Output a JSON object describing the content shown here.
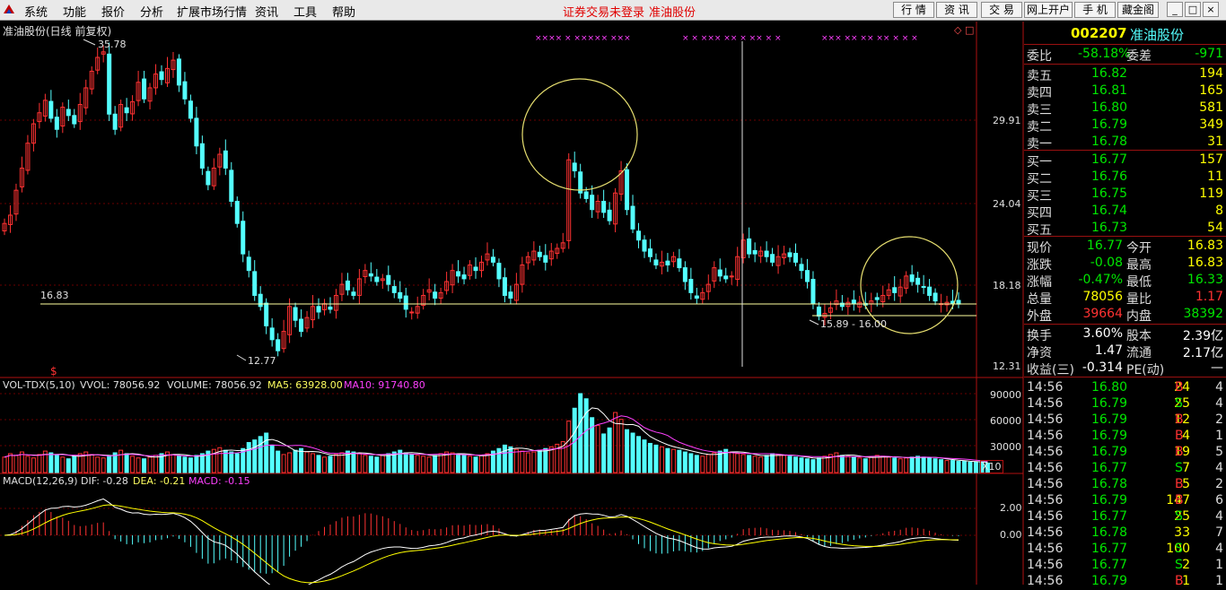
{
  "menubar": {
    "items": [
      "系统",
      "功能",
      "报价",
      "分析",
      "扩展市场行情",
      "资讯",
      "工具",
      "帮助"
    ],
    "notice": "证券交易未登录",
    "stock_name": "准油股份",
    "right_buttons": [
      "行 情",
      "资 讯",
      "交 易",
      "网上开户",
      "手 机",
      "藏金阁"
    ],
    "window_buttons": [
      "_",
      "□",
      "×"
    ]
  },
  "chart_header": {
    "title": "准油股份(日线 前复权)",
    "high_label": "35.78",
    "low_label": "12.77",
    "price_line_label": "16.83",
    "range_label": "15.89 - 16.00",
    "top_right_symbols": "◇ □"
  },
  "price_axis": {
    "ticks": [
      "29.91",
      "24.04",
      "18.18",
      "12.31"
    ]
  },
  "volume_panel": {
    "indicator": "VOL-TDX(5,10)",
    "vvol": "VVOL: 78056.92",
    "volume": "VOLUME: 78056.92",
    "ma5": "MA5: 63928.00",
    "ma10": "MA10: 91740.80",
    "ticks": [
      "90000",
      "60000",
      "30000"
    ],
    "unit": "X10"
  },
  "macd_panel": {
    "indicator": "MACD(12,26,9)",
    "dif": "DIF: -0.28",
    "dea": "DEA: -0.21",
    "macd": "MACD: -0.15",
    "ticks": [
      "2.00",
      "0.00"
    ]
  },
  "quote_panel": {
    "code": "002207",
    "name": "准油股份",
    "webi_label": "委比",
    "webi_value": "-58.18%",
    "weicha_label": "委差",
    "weicha_value": "-971",
    "asks": [
      {
        "label": "卖五",
        "price": "16.82",
        "vol": "194"
      },
      {
        "label": "卖四",
        "price": "16.81",
        "vol": "165"
      },
      {
        "label": "卖三",
        "price": "16.80",
        "vol": "581"
      },
      {
        "label": "卖二",
        "price": "16.79",
        "vol": "349"
      },
      {
        "label": "卖一",
        "price": "16.78",
        "vol": "31"
      }
    ],
    "bids": [
      {
        "label": "买一",
        "price": "16.77",
        "vol": "157"
      },
      {
        "label": "买二",
        "price": "16.76",
        "vol": "11"
      },
      {
        "label": "买三",
        "price": "16.75",
        "vol": "119"
      },
      {
        "label": "买四",
        "price": "16.74",
        "vol": "8"
      },
      {
        "label": "买五",
        "price": "16.73",
        "vol": "54"
      }
    ],
    "stats": [
      {
        "l1": "现价",
        "v1": "16.77",
        "l2": "今开",
        "v2": "16.83"
      },
      {
        "l1": "涨跌",
        "v1": "-0.08",
        "l2": "最高",
        "v2": "16.83"
      },
      {
        "l1": "涨幅",
        "v1": "-0.47%",
        "l2": "最低",
        "v2": "16.33"
      },
      {
        "l1": "总量",
        "v1": "78056",
        "l2": "量比",
        "v2": "1.17"
      },
      {
        "l1": "外盘",
        "v1": "39664",
        "l2": "内盘",
        "v2": "38392"
      }
    ],
    "fundamentals": [
      {
        "l1": "换手",
        "v1": "3.60%",
        "l2": "股本",
        "v2": "2.39亿"
      },
      {
        "l1": "净资",
        "v1": "1.47",
        "l2": "流通",
        "v2": "2.17亿"
      },
      {
        "l1": "收益(三)",
        "v1": "-0.314",
        "l2": "PE(动)",
        "v2": "—"
      }
    ],
    "ticks": [
      {
        "time": "14:56",
        "price": "16.80",
        "vol": "24",
        "side": "B",
        "n": "4"
      },
      {
        "time": "14:56",
        "price": "16.79",
        "vol": "25",
        "side": "S",
        "n": "4"
      },
      {
        "time": "14:56",
        "price": "16.79",
        "vol": "12",
        "side": "B",
        "n": "2"
      },
      {
        "time": "14:56",
        "price": "16.79",
        "vol": "4",
        "side": "B",
        "n": "1"
      },
      {
        "time": "14:56",
        "price": "16.79",
        "vol": "19",
        "side": "B",
        "n": "5"
      },
      {
        "time": "14:56",
        "price": "16.77",
        "vol": "7",
        "side": "S",
        "n": "4"
      },
      {
        "time": "14:56",
        "price": "16.78",
        "vol": "5",
        "side": "B",
        "n": "2"
      },
      {
        "time": "14:56",
        "price": "16.79",
        "vol": "147",
        "side": "B",
        "n": "6"
      },
      {
        "time": "14:56",
        "price": "16.77",
        "vol": "25",
        "side": "S",
        "n": "4"
      },
      {
        "time": "14:56",
        "price": "16.78",
        "vol": "33",
        "side": "",
        "n": "7"
      },
      {
        "time": "14:56",
        "price": "16.77",
        "vol": "100",
        "side": "S",
        "n": "4"
      },
      {
        "time": "14:56",
        "price": "16.77",
        "vol": "2",
        "side": "S",
        "n": "1"
      },
      {
        "time": "14:56",
        "price": "16.79",
        "vol": "1",
        "side": "B",
        "n": "1"
      }
    ]
  },
  "colors": {
    "up": "#ff3232",
    "down": "#54ffff",
    "ma5": "#ffffff",
    "ma10": "#ff40ff",
    "dif": "#ffffff",
    "dea": "#ffff00",
    "grid": "#8b0000",
    "label_yellow": "#ffff00",
    "green": "#00e600"
  },
  "chart_data": [
    {
      "type": "candlestick",
      "title": "准油股份(日线 前复权)",
      "ylim": [
        12.31,
        35.78
      ],
      "y_ticks": [
        29.91,
        24.04,
        18.18,
        12.31
      ],
      "annotations": [
        "35.78",
        "12.77",
        "16.83",
        "15.89 - 16.00"
      ],
      "close": [
        22.6,
        23.2,
        25,
        26.6,
        28.4,
        29.8,
        30.6,
        31.5,
        30.2,
        29.4,
        31,
        30.4,
        29.8,
        31.2,
        32.4,
        33.6,
        34.6,
        35,
        30.5,
        29.4,
        31.2,
        30.6,
        31.4,
        32.8,
        31.6,
        32.4,
        33.4,
        33,
        33.8,
        34.4,
        32.6,
        31.6,
        30.2,
        28.2,
        26.6,
        25.4,
        26.6,
        27.6,
        26.6,
        24.2,
        22.6,
        20.4,
        19.2,
        17.4,
        16.6,
        15.2,
        14.2,
        13.4,
        14.8,
        16.6,
        15.6,
        14.8,
        15.8,
        16.6,
        16.2,
        16.8,
        16.4,
        17.4,
        18.2,
        17.8,
        17.4,
        18.6,
        19.2,
        18.8,
        18.4,
        18.6,
        18.2,
        17.6,
        17.2,
        16.4,
        16.2,
        16.6,
        17.4,
        17.8,
        17.2,
        17.6,
        18.4,
        19.2,
        18.8,
        18.6,
        19.6,
        19.2,
        19.8,
        20.4,
        19.8,
        18.6,
        17.4,
        17.2,
        18.2,
        19.6,
        20.2,
        20.6,
        20.2,
        19.8,
        20.6,
        20.8,
        21.2,
        27.2,
        26.4,
        24.8,
        24.4,
        23.6,
        24.2,
        23.4,
        22.8,
        24.8,
        26.4,
        23.6,
        22.2,
        21.4,
        20.6,
        20.2,
        19.6,
        19.8,
        19.6,
        20.2,
        19.4,
        18.4,
        17.6,
        17.2,
        17.6,
        18.2,
        19.4,
        18.8,
        18.6,
        18.8,
        20.2,
        21.4,
        20.4,
        20.4,
        20.6,
        20.2,
        19.8,
        20.2,
        20.4,
        20.2,
        19.8,
        19.2,
        18.4,
        16.8,
        15.9,
        16.1,
        16.5,
        17,
        16.6,
        16.9,
        16.8,
        16.9,
        16.7,
        17,
        17.1,
        17.4,
        17.8,
        17.6,
        18,
        18.8,
        18.4,
        18.2,
        18,
        17.4,
        17,
        16.8,
        16.9,
        16.8,
        16.77
      ],
      "x_count": 170
    },
    {
      "type": "bar",
      "title": "VOL-TDX(5,10)",
      "series": [
        {
          "name": "VOLUME",
          "last": 78056.92
        },
        {
          "name": "MA5",
          "last": 63928.0
        },
        {
          "name": "MA10",
          "last": 91740.8
        }
      ],
      "y_ticks": [
        90000,
        60000,
        30000
      ],
      "values": [
        18,
        22,
        20,
        24,
        19,
        17,
        21,
        25,
        23,
        20,
        18,
        16,
        19,
        22,
        24,
        21,
        18,
        17,
        20,
        23,
        26,
        22,
        19,
        17,
        16,
        18,
        20,
        22,
        24,
        21,
        19,
        18,
        17,
        20,
        22,
        25,
        27,
        29,
        26,
        24,
        22,
        28,
        35,
        38,
        42,
        46,
        32,
        25,
        21,
        23,
        26,
        28,
        24,
        22,
        20,
        18,
        19,
        21,
        23,
        25,
        24,
        22,
        20,
        19,
        18,
        20,
        22,
        24,
        26,
        23,
        21,
        20,
        19,
        18,
        20,
        22,
        24,
        23,
        21,
        20,
        19,
        18,
        20,
        22,
        25,
        28,
        32,
        30,
        27,
        25,
        23,
        24,
        26,
        28,
        30,
        33,
        36,
        60,
        75,
        92,
        86,
        64,
        55,
        45,
        52,
        70,
        62,
        50,
        46,
        42,
        38,
        34,
        32,
        30,
        28,
        27,
        26,
        24,
        22,
        20,
        19,
        21,
        23,
        25,
        27,
        24,
        22,
        21,
        20,
        19,
        18,
        20,
        22,
        21,
        20,
        19,
        18,
        17,
        16,
        15,
        17,
        19,
        21,
        23,
        20,
        19,
        18,
        17,
        16,
        18,
        20,
        19,
        18,
        17,
        16,
        17,
        18,
        19,
        18,
        17,
        16,
        15,
        14,
        14,
        13,
        13,
        12,
        12,
        12,
        11
      ]
    },
    {
      "type": "line",
      "title": "MACD(12,26,9)",
      "series": [
        {
          "name": "DIF",
          "last": -0.28
        },
        {
          "name": "DEA",
          "last": -0.21
        },
        {
          "name": "MACD",
          "last": -0.15
        }
      ],
      "y_ticks": [
        2.0,
        0.0
      ]
    }
  ]
}
